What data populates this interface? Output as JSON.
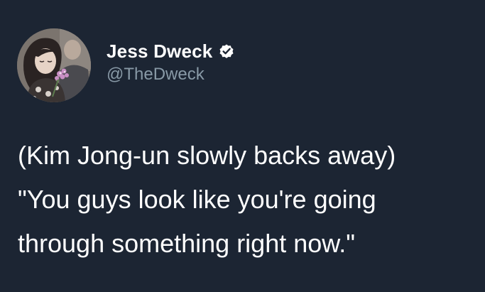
{
  "author": {
    "display_name": "Jess Dweck",
    "handle": "@TheDweck",
    "verified": true,
    "avatar_icon": "profile-photo"
  },
  "tweet": {
    "lines": [
      "(Kim Jong-un slowly backs away)",
      "\"You guys look like you're going",
      "through something right now.\""
    ]
  },
  "colors": {
    "background": "#1c2533",
    "text": "#ffffff",
    "handle": "#8899a6",
    "verified_badge": "#ffffff"
  }
}
